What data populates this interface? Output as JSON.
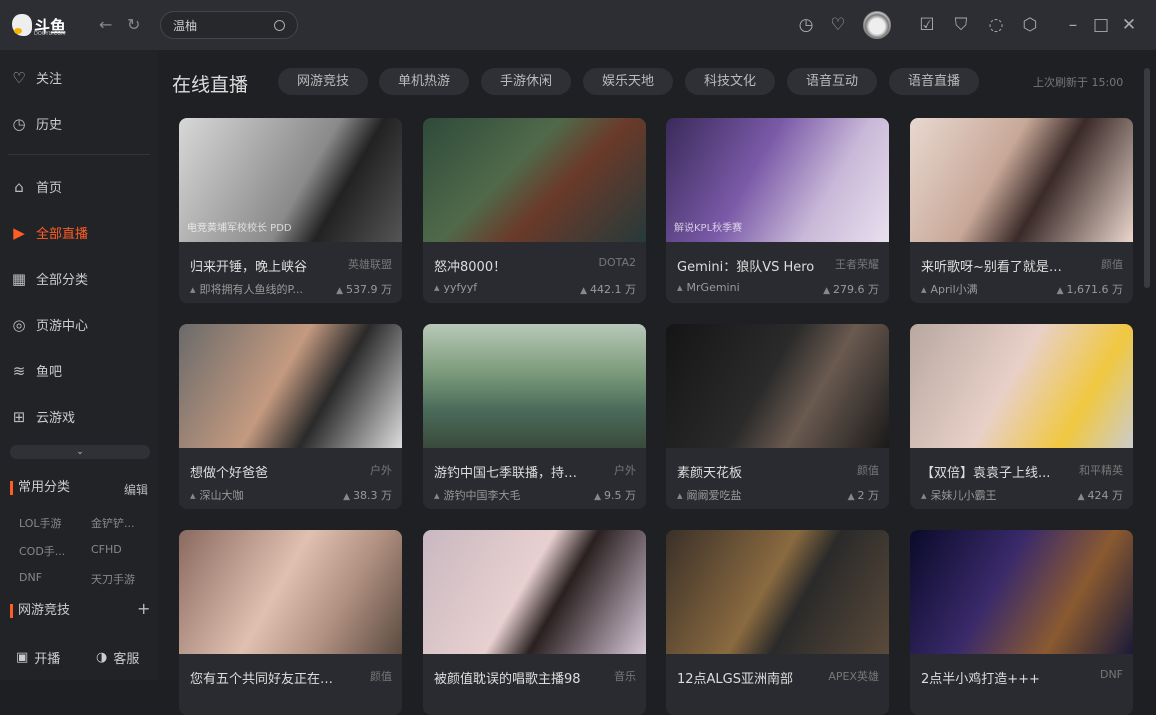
{
  "header": {
    "logo_text": "斗鱼",
    "logo_sub": "DOUYU.COM",
    "search_value": "温柚",
    "icons": [
      "history-icon",
      "heart-icon",
      "avatar",
      "calendar-check-icon",
      "tshirt-icon",
      "chat-icon",
      "settings-hexagon-icon",
      "minimize-icon",
      "maximize-icon",
      "close-icon"
    ]
  },
  "sidebar": {
    "items": [
      {
        "label": "关注",
        "icon": "♡"
      },
      {
        "label": "历史",
        "icon": "◷"
      },
      {
        "label": "首页",
        "icon": "⌂"
      },
      {
        "label": "全部直播",
        "icon": "▶"
      },
      {
        "label": "全部分类",
        "icon": "▦"
      },
      {
        "label": "页游中心",
        "icon": "◎"
      },
      {
        "label": "鱼吧",
        "icon": "≋"
      },
      {
        "label": "云游戏",
        "icon": "⊞"
      }
    ],
    "expand_icon": "⌄",
    "common": {
      "title": "常用分类",
      "action": "编辑",
      "cats": [
        "LOL手游",
        "金铲铲...",
        "COD手...",
        "CFHD",
        "DNF",
        "天刀手游"
      ]
    },
    "group": {
      "title": "网游竞技",
      "action": "+"
    },
    "bottom": [
      {
        "label": "开播",
        "icon": "▣"
      },
      {
        "label": "客服",
        "icon": "◑"
      }
    ]
  },
  "main": {
    "title": "在线直播",
    "tabs": [
      "网游竞技",
      "单机热游",
      "手游休闲",
      "娱乐天地",
      "科技文化",
      "语音互动",
      "语音直播"
    ],
    "refresh": "上次刷新于 15:00",
    "cards": [
      {
        "title": "归来开锤，晚上峡谷",
        "category": "英雄联盟",
        "host": "即将拥有人鱼线的P...",
        "hot": "537.9 万",
        "bg": "linear-gradient(120deg,#d8d8d8,#8a8a8a 55%,#222 70%,#555)",
        "tag": "电竞黄埔军校校长 PDD"
      },
      {
        "title": "怒冲8000！",
        "category": "DOTA2",
        "host": "yyfyyf",
        "hot": "442.1 万",
        "bg": "linear-gradient(135deg,#2f4a3a,#4f6a4a 40%,#6a3a2a 60%,#263a3a)",
        "tag": ""
      },
      {
        "title": "Gemini：狼队VS Hero",
        "category": "王者荣耀",
        "host": "MrGemini",
        "hot": "279.6 万",
        "bg": "linear-gradient(120deg,#3a2a5a,#7a5aa8 40%,#c9b8d8 70%,#e8e0ee)",
        "tag": "解说KPL秋季赛"
      },
      {
        "title": "来听歌呀~别看了就是我...",
        "category": "颜值",
        "host": "April小满",
        "hot": "1,671.6 万",
        "bg": "linear-gradient(120deg,#e8d8d0,#c8a898 40%,#3a2a28 60%,#ead6cc)",
        "tag": ""
      },
      {
        "title": "想做个好爸爸",
        "category": "户外",
        "host": "深山大咖",
        "hot": "38.3 万",
        "bg": "linear-gradient(120deg,#6a6a6a,#c49a80 45%,#2a2a2a 65%,#ddd)",
        "tag": ""
      },
      {
        "title": "游钓中国七季联播，持续...",
        "category": "户外",
        "host": "游钓中国李大毛",
        "hot": "9.5 万",
        "bg": "linear-gradient(180deg,#b8c8b8,#7a9a7a 40%,#4a6a5a 70%,#3a4a3a)",
        "tag": ""
      },
      {
        "title": "素颜天花板",
        "category": "颜值",
        "host": "阚阚爱吃盐",
        "hot": "2 万",
        "bg": "linear-gradient(120deg,#151515,#2a2a2a 45%,#6a5a50 65%,#1a1a1a)",
        "tag": ""
      },
      {
        "title": "【双倍】袁袁子上线...",
        "category": "和平精英",
        "host": "呆妹儿小霸王",
        "hot": "424 万",
        "bg": "linear-gradient(120deg,#b8a8a0,#e8d0c8 45%,#f0c840 75%,#ccc)",
        "tag": ""
      },
      {
        "title": "您有五个共同好友正在观...",
        "category": "颜值",
        "host": "",
        "hot": "",
        "bg": "linear-gradient(120deg,#8a6a60,#e0c0b0 45%,#b09080 70%,#5a4a40)",
        "tag": ""
      },
      {
        "title": "被颜值耽误的唱歌主播98",
        "category": "音乐",
        "host": "",
        "hot": "",
        "bg": "linear-gradient(120deg,#c8b8c0,#e8d0d0 45%,#2a2020 60%,#d8c8d8)",
        "tag": ""
      },
      {
        "title": "12点ALGS亚洲南部",
        "category": "APEX英雄",
        "host": "",
        "hot": "",
        "bg": "linear-gradient(120deg,#3a3028,#8a6a40 45%,#2a2a2a 60%,#5a4a3a)",
        "tag": ""
      },
      {
        "title": "2点半小鸡打造+++",
        "category": "DNF",
        "host": "",
        "hot": "",
        "bg": "linear-gradient(120deg,#0a0a2a,#3a2a6a 40%,#8a5a30 70%,#1a1a3a)",
        "tag": ""
      }
    ]
  }
}
